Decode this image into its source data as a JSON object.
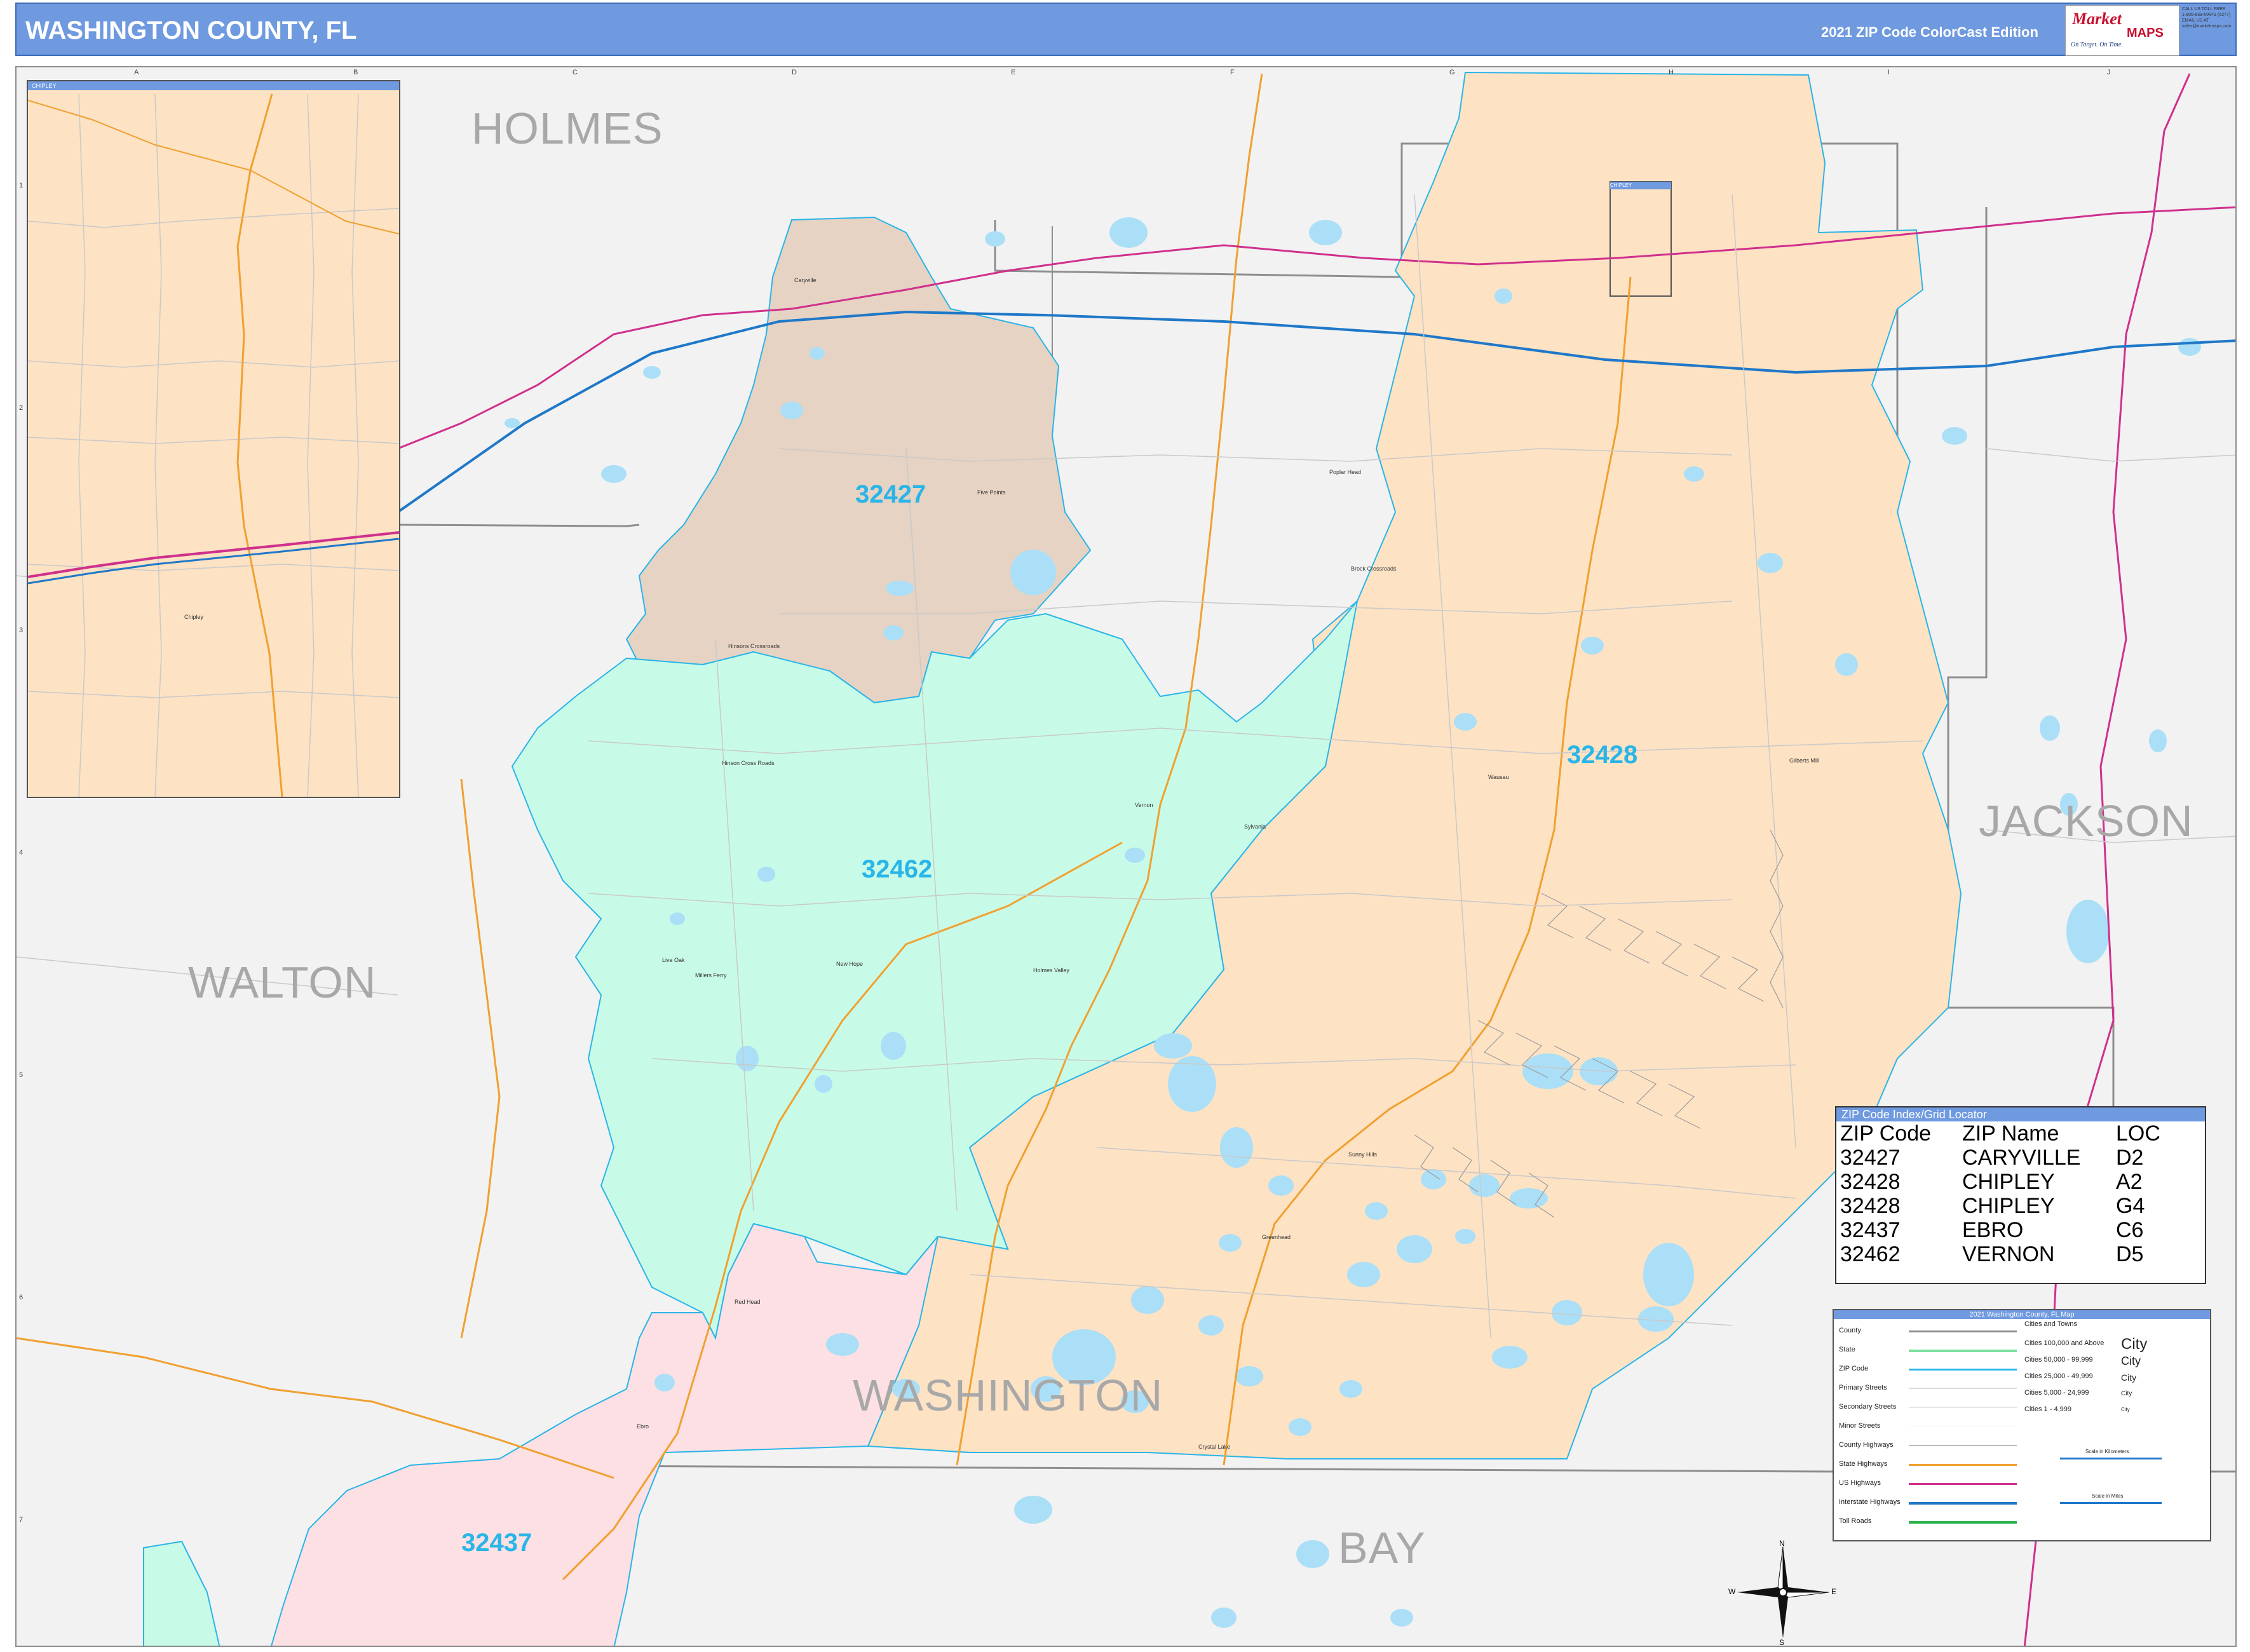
{
  "header": {
    "title": "WASHINGTON COUNTY, FL",
    "edition": "2021 ZIP Code ColorCast Edition"
  },
  "logo": {
    "brand": "Market",
    "maps": "MAPS",
    "tagline": "On Target. On Time.",
    "subtagline": "America's Leading Source of Business Maps",
    "contact": [
      "CALL US TOLL FREE",
      "1-800-839-MAPS (6277)",
      "EMAIL US AT",
      "sales@marketmaps.com"
    ]
  },
  "grid": {
    "columns": [
      "A",
      "B",
      "C",
      "D",
      "E",
      "F",
      "G",
      "H",
      "I",
      "J"
    ],
    "rows": [
      "1",
      "2",
      "3",
      "4",
      "5",
      "6",
      "7"
    ]
  },
  "counties": {
    "holmes": "HOLMES",
    "walton": "WALTON",
    "jackson": "JACKSON",
    "washington": "WASHINGTON",
    "bay": "BAY"
  },
  "zips": {
    "z32427": "32427",
    "z32428": "32428",
    "z32462": "32462",
    "z32437": "32437"
  },
  "cities": {
    "caryville": "Caryville",
    "five_points": "Five Points",
    "poplar_head": "Poplar Head",
    "brock_crossroads": "Brock Crossroads",
    "hinsons_crossroads": "Hinsons Crossroads",
    "hinson_cross_roads": "Hinson Cross Roads",
    "wausau": "Wausau",
    "gilberts_mill": "Gilberts Mill",
    "vernon": "Vernon",
    "sylvania": "Sylvania",
    "live_oak": "Live Oak",
    "millers_ferry": "Millers Ferry",
    "new_hope": "New Hope",
    "holmes_valley": "Holmes Valley",
    "sunny_hills": "Sunny Hills",
    "greenhead": "Greenhead",
    "red_head": "Red Head",
    "ebro": "Ebro",
    "crystal_lake": "Crystal Lake",
    "chipley": "Chipley"
  },
  "inset": {
    "title": "CHIPLEY",
    "city": "Chipley"
  },
  "small_box_label": "CHIPLEY",
  "zip_index": {
    "title": "ZIP Code Index/Grid Locator",
    "headers": [
      "ZIP Code",
      "ZIP Name",
      "LOC"
    ],
    "rows": [
      [
        "32427",
        "CARYVILLE",
        "D2"
      ],
      [
        "32428",
        "CHIPLEY",
        "A2"
      ],
      [
        "32428",
        "CHIPLEY",
        "G4"
      ],
      [
        "32437",
        "EBRO",
        "C6"
      ],
      [
        "32462",
        "VERNON",
        "D5"
      ]
    ]
  },
  "legend": {
    "title": "2021 Washington County, FL Map",
    "items": [
      "County",
      "State",
      "ZIP Code",
      "Primary Streets",
      "Secondary Streets",
      "Minor Streets",
      "County Highways",
      "State Highways",
      "US Highways",
      "Interstate Highways",
      "Toll Roads"
    ],
    "cities_title": "Cities and Towns",
    "city_rows": [
      "Cities 100,000 and Above",
      "Cities 50,000 - 99,999",
      "Cities 25,000 - 49,999",
      "Cities 5,000 - 24,999",
      "Cities 1 - 4,999"
    ],
    "city_samples": [
      "City",
      "City",
      "City",
      "City",
      "City"
    ],
    "scale_km": "Scale in Kilometers",
    "scale_mi": "Scale in Miles"
  },
  "compass": {
    "n": "N",
    "s": "S",
    "e": "E",
    "w": "W"
  },
  "colors": {
    "zip_32427": "#e6d3c3",
    "zip_32428": "#fde2c4",
    "zip_32462": "#c8fbe7",
    "zip_32437": "#fde0e3",
    "outside": "#f2f2f2",
    "water": "#aadff7",
    "interstate": "#1f78c8",
    "us_highway": "#d0308c",
    "state_highway": "#f0a030",
    "zip_border": "#29b5e8",
    "header": "#6f9ae0"
  }
}
